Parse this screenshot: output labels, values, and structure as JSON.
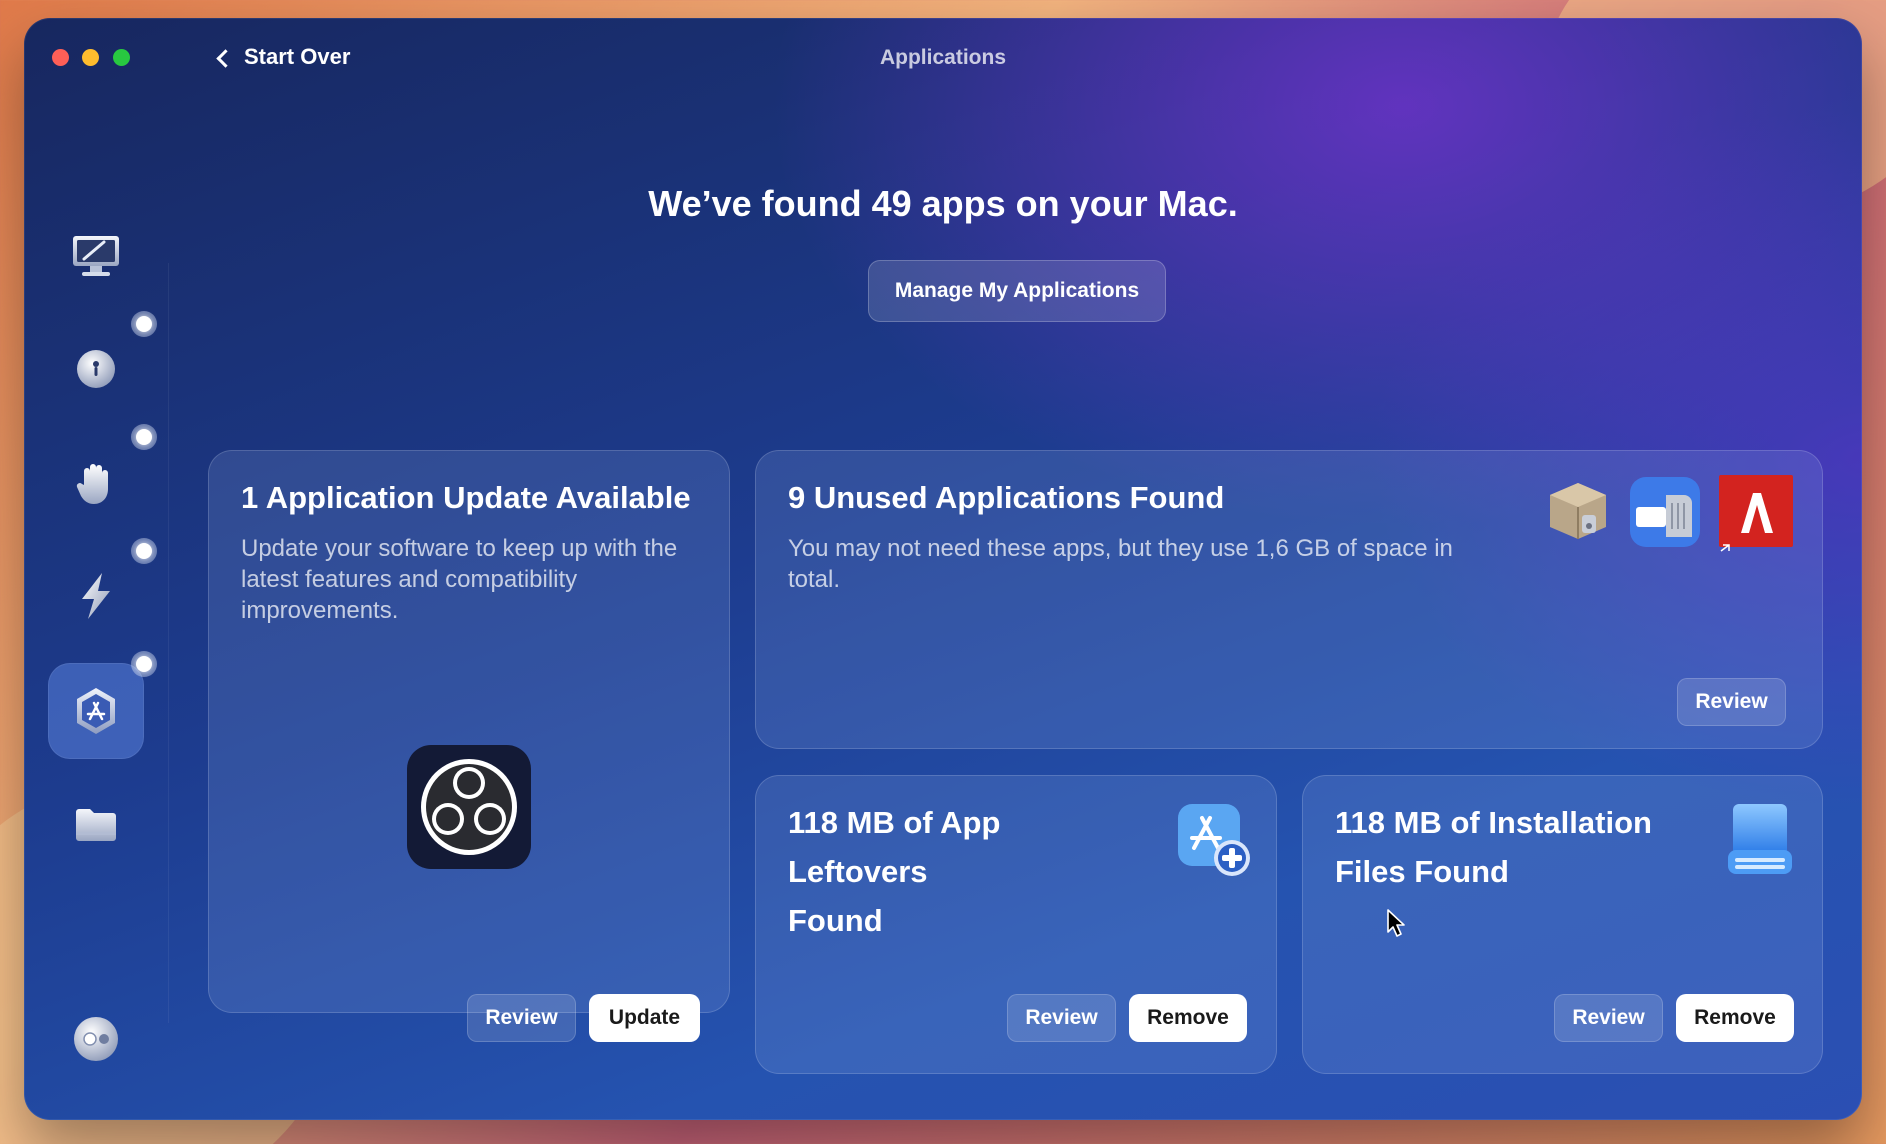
{
  "window": {
    "title": "Applications"
  },
  "nav": {
    "back_label": "Start Over"
  },
  "sidebar": {
    "items": [
      {
        "name": "cleanup",
        "icon": "monitor-broom-icon",
        "active": false,
        "badge": false
      },
      {
        "name": "protection",
        "icon": "shield-ball-icon",
        "active": false,
        "badge": true
      },
      {
        "name": "privacy",
        "icon": "hand-icon",
        "active": false,
        "badge": true
      },
      {
        "name": "speed",
        "icon": "lightning-icon",
        "active": false,
        "badge": true
      },
      {
        "name": "applications",
        "icon": "app-store-icon",
        "active": true,
        "badge": true
      },
      {
        "name": "files",
        "icon": "folder-icon",
        "active": false,
        "badge": false
      }
    ],
    "bottom_icon": "assistant-toggle-icon"
  },
  "main": {
    "headline": "We’ve found 49 apps on your Mac.",
    "manage_button": "Manage My Applications"
  },
  "cards": {
    "updates": {
      "title": "1 Application Update Available",
      "description": "Update your software to keep up with the latest features and compatibility improvements.",
      "app_icon": "obs-studio-icon",
      "review_label": "Review",
      "action_label": "Update"
    },
    "unused": {
      "title": "9 Unused Applications Found",
      "description": "You may not need these apps, but they use 1,6 GB of space in total.",
      "icons": [
        "package-box-icon",
        "zip-archiver-icon",
        "adobe-icon"
      ],
      "review_label": "Review"
    },
    "leftovers": {
      "title_line1": "118 MB of App Leftovers",
      "title_line2": "Found",
      "icon": "app-leftovers-icon",
      "review_label": "Review",
      "action_label": "Remove"
    },
    "installation": {
      "title_line1": "118 MB of Installation",
      "title_line2": "Files Found",
      "icon": "installer-disk-icon",
      "review_label": "Review",
      "action_label": "Remove"
    }
  }
}
